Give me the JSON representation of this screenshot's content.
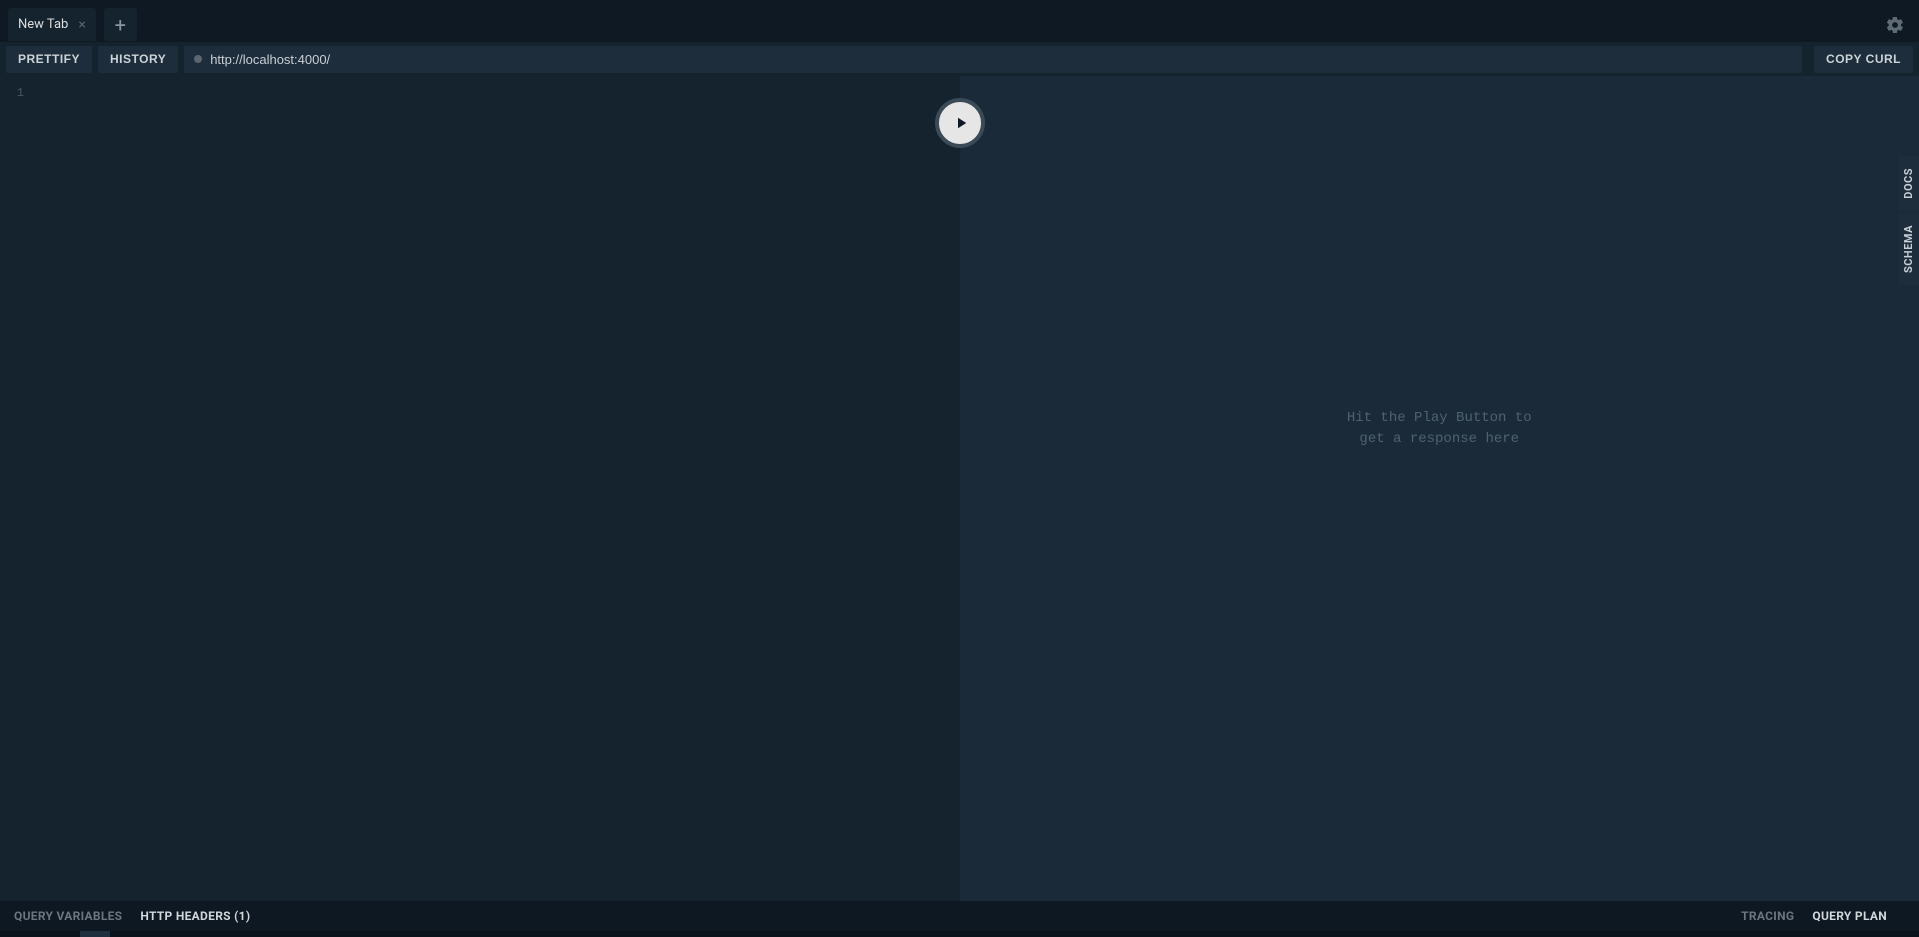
{
  "tabs": [
    {
      "label": "New Tab"
    }
  ],
  "toolbar": {
    "prettify": "PRETTIFY",
    "history": "HISTORY",
    "copy_curl": "COPY CURL",
    "endpoint_value": "http://localhost:4000/"
  },
  "editor": {
    "line_number": "1"
  },
  "result": {
    "placeholder": "Hit the Play Button to\nget a response here"
  },
  "side": {
    "docs": "DOCS",
    "schema": "SCHEMA"
  },
  "footer": {
    "query_variables": "QUERY VARIABLES",
    "http_headers": "HTTP HEADERS (1)",
    "tracing": "TRACING",
    "query_plan": "QUERY PLAN"
  }
}
